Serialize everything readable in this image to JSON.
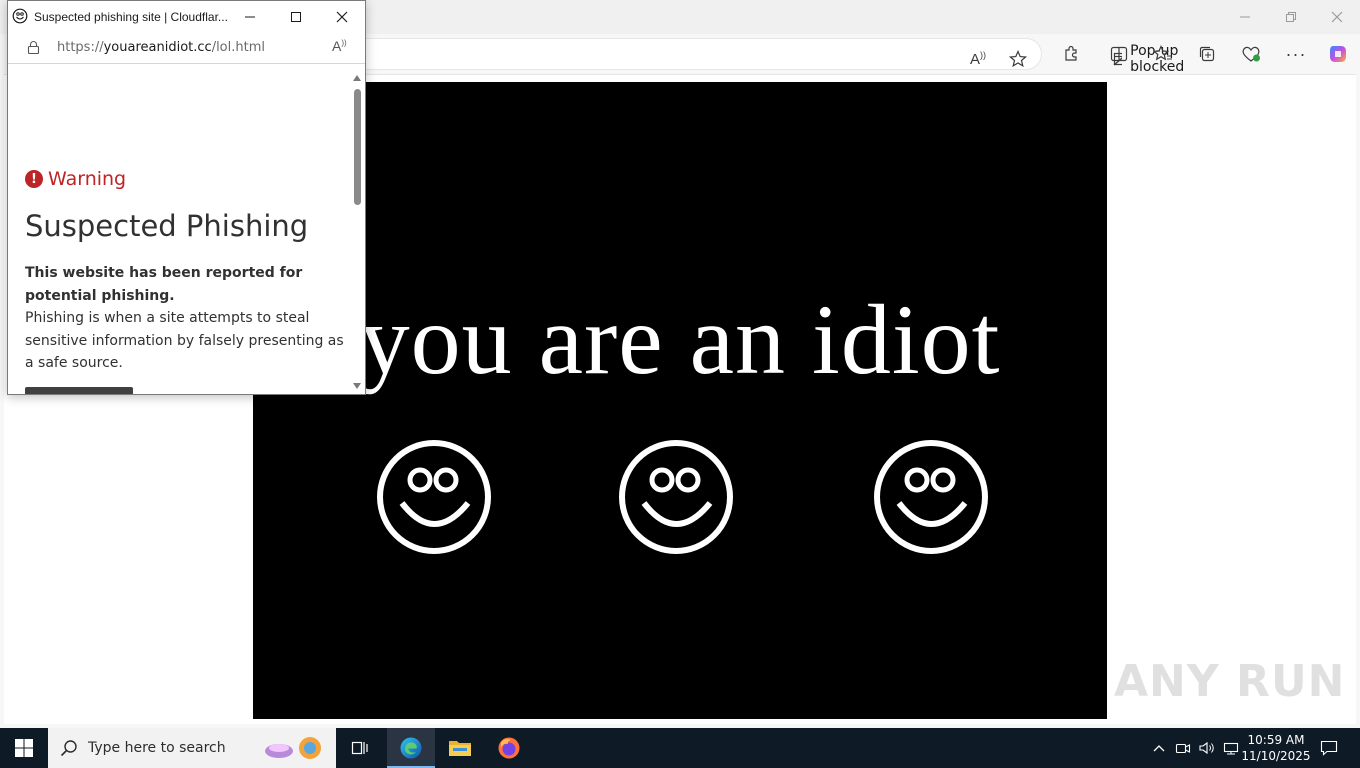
{
  "browser": {
    "toolbar": {
      "popup_blocked_label": "Pop-up blocked"
    },
    "page": {
      "headline": "you are an idiot"
    },
    "watermark": "ANY RUN"
  },
  "popup": {
    "title": "Suspected phishing site | Cloudflar...",
    "url_prefix": "https://",
    "url_host": "youareanidiot.cc",
    "url_path": "/lol.html",
    "warning_label": "Warning",
    "heading": "Suspected Phishing",
    "body_bold": "This website has been reported for potential phishing.",
    "body_text": "Phishing is when a site attempts to steal sensitive information by falsely presenting as a safe source."
  },
  "taskbar": {
    "search_placeholder": "Type here to search",
    "time": "10:59 AM",
    "date": "11/10/2025"
  },
  "colors": {
    "warning_red": "#bd2426",
    "taskbar_bg": "#0f1a27",
    "stage_bg": "#000000"
  },
  "icons": [
    "smiley-icon",
    "lock-icon",
    "read-aloud-icon",
    "favorite-star-icon",
    "extensions-icon",
    "split-screen-icon",
    "favorites-icon",
    "collections-icon",
    "browser-essentials-icon",
    "more-icon",
    "copilot-icon",
    "windows-start-icon",
    "search-icon",
    "task-view-icon",
    "edge-icon",
    "file-explorer-icon",
    "firefox-icon",
    "notification-icon"
  ]
}
